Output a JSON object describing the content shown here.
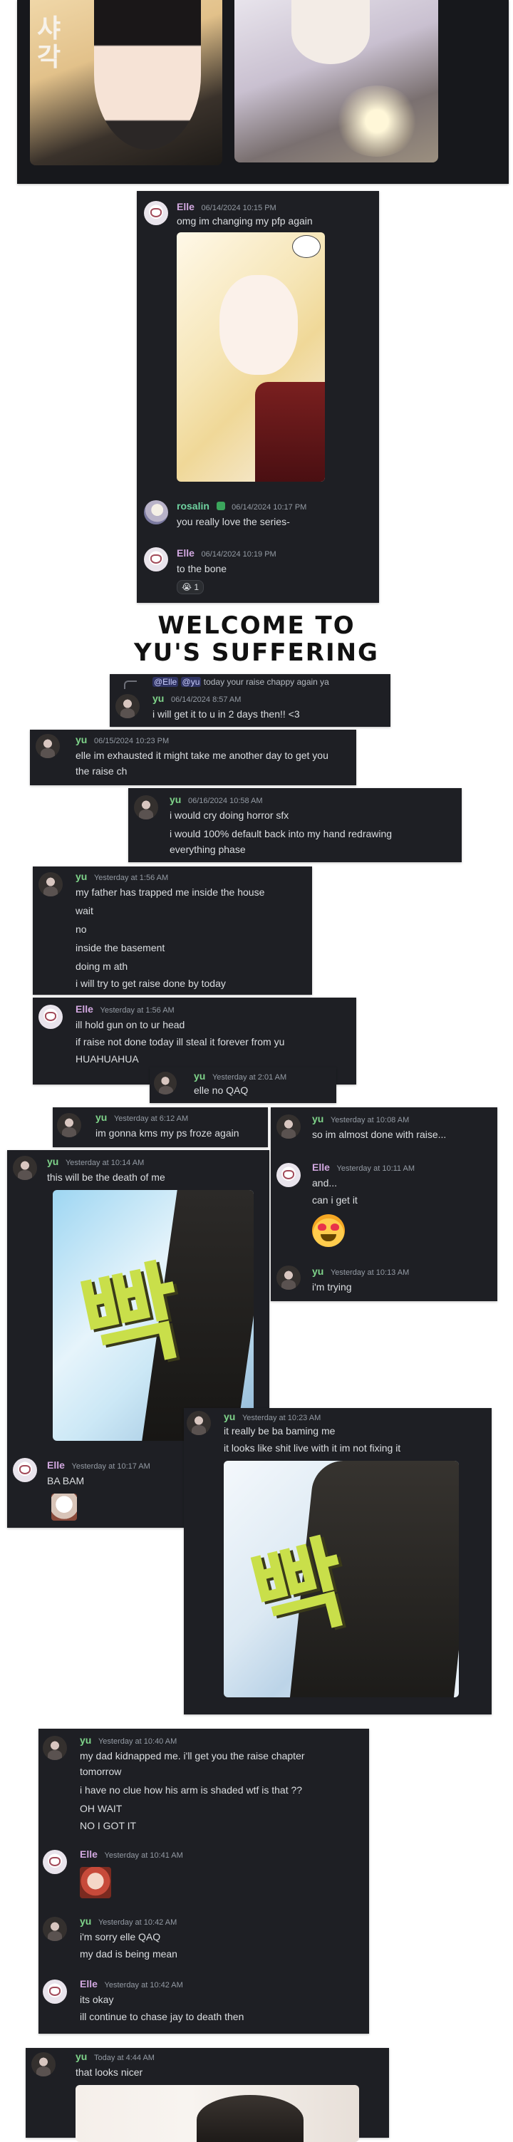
{
  "card1": {
    "sender": "Elle",
    "timestamp": "06/14/2024 10:15 PM",
    "text": "omg im changing my pfp again"
  },
  "card1_reply1": {
    "sender": "rosalin",
    "timestamp": "06/14/2024 10:17 PM",
    "text": "you really love the series-"
  },
  "card1_reply2": {
    "sender": "Elle",
    "timestamp": "06/14/2024 10:19 PM",
    "text": "to the bone",
    "reaction": "😭 1"
  },
  "heading": {
    "line1": "WELCOME TO",
    "line2": "YU'S SUFFERING"
  },
  "card2": {
    "reply_name": "@Elle",
    "reply_mention": "@yu",
    "reply_text": "today your raise chappy again ya",
    "sender": "yu",
    "timestamp": "06/14/2024 8:57 AM",
    "text": "i will get it to u in 2 days then!! <3"
  },
  "card3": {
    "sender": "yu",
    "timestamp": "06/15/2024 10:23 PM",
    "lines": [
      "elle im exhausted it might take me another day to get you",
      "the raise ch"
    ]
  },
  "card4": {
    "sender": "yu",
    "timestamp": "06/16/2024 10:58 AM",
    "lines": [
      "i would cry doing horror sfx",
      "i would 100% default back into my hand redrawing",
      "everything phase"
    ]
  },
  "card5": {
    "sender": "yu",
    "timestamp": "Yesterday at 1:56 AM",
    "lines": [
      "my father has trapped me inside the house",
      "wait",
      "no",
      "inside the basement",
      "doing m ath",
      "i will try to get raise done by today"
    ]
  },
  "card6": {
    "sender": "Elle",
    "timestamp": "Yesterday at 1:56 AM",
    "lines": [
      "ill hold gun on to ur head",
      "if raise not done today ill steal it forever from yu",
      "HUAHUAHUA"
    ]
  },
  "card6b": {
    "sender": "yu",
    "timestamp": "Yesterday at 2:01 AM",
    "text": "elle no QAQ"
  },
  "card7": {
    "sender": "yu",
    "timestamp": "Yesterday at 6:12 AM",
    "text": "im gonna kms my ps froze again"
  },
  "card8": {
    "m1_sender": "yu",
    "m1_timestamp": "Yesterday at 10:08 AM",
    "m1_text": "so im almost done with raise...",
    "m2_sender": "Elle",
    "m2_timestamp": "Yesterday at 10:11 AM",
    "m2_lines": [
      "and...",
      "can i get it"
    ],
    "m3_sender": "yu",
    "m3_timestamp": "Yesterday at 10:13 AM",
    "m3_text": "i'm trying"
  },
  "card9": {
    "sender": "yu",
    "timestamp": "Yesterday at 10:14 AM",
    "text": "this will be the death of me",
    "sfx": "빡",
    "r_sender": "Elle",
    "r_timestamp": "Yesterday at 10:17 AM",
    "r_text": "BA BAM"
  },
  "card10": {
    "sender": "yu",
    "timestamp": "Yesterday at 10:23 AM",
    "lines": [
      "it really be ba baming me",
      "it looks like shit live with it im not fixing it"
    ],
    "sfx": "빡"
  },
  "card11": {
    "m1_sender": "yu",
    "m1_timestamp": "Yesterday at 10:40 AM",
    "m1_lines": [
      "my dad kidnapped me. i'll get you the raise chapter",
      "tomorrow",
      "i have no clue how his arm is shaded wtf is that ??",
      "OH WAIT",
      "NO I GOT IT"
    ],
    "m2_sender": "Elle",
    "m2_timestamp": "Yesterday at 10:41 AM",
    "m3_sender": "yu",
    "m3_timestamp": "Yesterday at 10:42 AM",
    "m3_lines": [
      "i'm sorry elle QAQ",
      "my dad is being mean"
    ],
    "m4_sender": "Elle",
    "m4_timestamp": "Yesterday at 10:42 AM",
    "m4_lines": [
      "its okay",
      "ill continue to chase jay to death then"
    ]
  },
  "card12": {
    "sender": "yu",
    "timestamp": "Today at 4:44 AM",
    "text": "that looks nicer"
  },
  "colors": {
    "card_bg": "#1e1f24",
    "elle_name": "#d2a8e0",
    "yu_name": "#7fd48a",
    "timestamp": "#949ba4",
    "text": "#dbdee1"
  },
  "icons": [
    "elle-avatar",
    "yu-avatar",
    "rosalin-avatar",
    "verified-badge-icon",
    "sob-emoji",
    "heart-eyes-emoji",
    "reply-arrow-icon"
  ]
}
